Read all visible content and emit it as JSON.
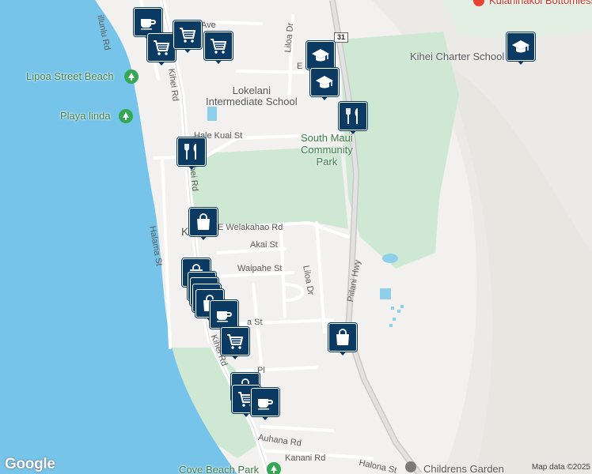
{
  "map": {
    "logo_text": "Google",
    "attribution": "Map data ©2025",
    "route_shield": "31",
    "place_labels": {
      "lipoa_beach": "Lipoa Street Beach",
      "playa_linda": "Playa linda",
      "cove_park": "Cove Beach Park",
      "lokelani": "Lokelani\nIntermediate School",
      "south_maui": "South Maui\nCommunity\nPark",
      "kihei_charter": "Kihei Charter School",
      "childrens_garden": "Childrens Garden",
      "top_right_partial": "Kulanihakoi Bottomless",
      "kihei_town": "Ki"
    },
    "street_labels": {
      "illunlu_rd": "illunlu Rd",
      "kihei_rd_n": "Kihei Rd",
      "kihei_rd_mid": "Kihei Rd",
      "kihei_rd_s": "Kihei Rd",
      "ave": "Ave",
      "liloa_dr_n": "Liloa Dr",
      "e_lipoa": "E L",
      "hale_kuai": "Hale Kuai St",
      "welakahao": "E Welakahao Rd",
      "akai": "Akai St",
      "waipahe": "Waipahe St",
      "liloa_dr_s": "Liloa Dr",
      "halama": "Halama St",
      "piilani": "Piilani Hwy",
      "ala_st": "a St",
      "pl": "Pl",
      "auhana": "Auhana Rd",
      "kanani": "Kanani Rd",
      "halona": "Halona St"
    },
    "markers": [
      {
        "icon": "coffee-icon"
      },
      {
        "icon": "cart-icon"
      },
      {
        "icon": "cart-icon"
      },
      {
        "icon": "cart-icon"
      },
      {
        "icon": "school-icon"
      },
      {
        "icon": "school-icon"
      },
      {
        "icon": "school-icon"
      },
      {
        "icon": "restaurant-icon"
      },
      {
        "icon": "restaurant-icon"
      },
      {
        "icon": "bag-icon"
      },
      {
        "icon": "bag-icon"
      },
      {
        "icon": "bag-icon"
      },
      {
        "icon": "bag-icon"
      },
      {
        "icon": "bag-icon"
      },
      {
        "icon": "bag-icon"
      },
      {
        "icon": "coffee-icon"
      },
      {
        "icon": "cart-icon"
      },
      {
        "icon": "bag-icon"
      },
      {
        "icon": "bag-icon"
      },
      {
        "icon": "cart-icon"
      },
      {
        "icon": "coffee-icon"
      }
    ],
    "colors": {
      "water": "#77c4ea",
      "land": "#f2f1ef",
      "park": "#cfe8d4",
      "marker": "#0b3a63",
      "road": "#ffffff",
      "highway": "#c9c9c9",
      "pin_green": "#34a853"
    }
  }
}
